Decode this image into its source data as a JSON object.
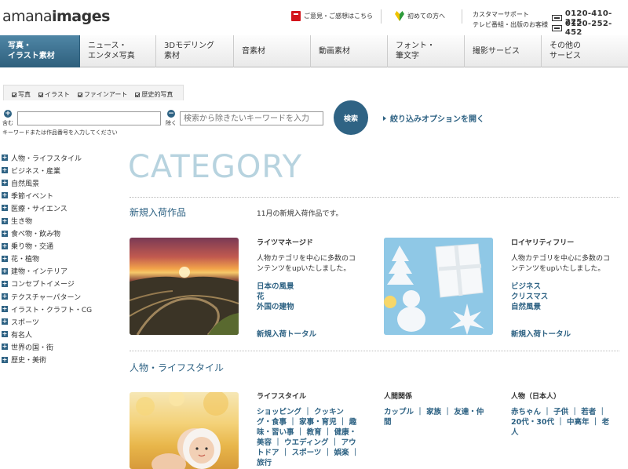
{
  "header": {
    "logo_light": "amana",
    "logo_bold": "images",
    "feedback_link": "ご意見・ご感想はこちら",
    "beginner_link": "初めての方へ",
    "support_title": "カスタマーサポート",
    "support_sub": "テレビ番組・出版のお客様",
    "tel_1": "0120-410-225",
    "tel_2": "0120-252-452"
  },
  "nav": {
    "items": [
      {
        "line1": "写真・",
        "line2": "イラスト素材"
      },
      {
        "line1": "ニュース・",
        "line2": "エンタメ写真"
      },
      {
        "line1": "3Dモデリング",
        "line2": "素材"
      },
      {
        "line1": "音素材",
        "line2": ""
      },
      {
        "line1": "動画素材",
        "line2": ""
      },
      {
        "line1": "フォント・",
        "line2": "筆文字"
      },
      {
        "line1": "撮影サービス",
        "line2": ""
      },
      {
        "line1": "その他の",
        "line2": "サービス"
      }
    ]
  },
  "search": {
    "checks": [
      "写真",
      "イラスト",
      "ファインアート",
      "歴史的写真"
    ],
    "include_label": "含む",
    "exclude_label": "除く",
    "exclude_placeholder": "検索から除きたいキーワードを入力",
    "hint": "キーワードまたは作品番号を入力してください",
    "button": "検索",
    "refine": "絞り込みオプションを開く"
  },
  "sidebar": {
    "items": [
      "人物・ライフスタイル",
      "ビジネス・産業",
      "自然風景",
      "季節イベント",
      "医療・サイエンス",
      "生き物",
      "食べ物・飲み物",
      "乗り物・交通",
      "花・植物",
      "建物・インテリア",
      "コンセプトイメージ",
      "テクスチャーパターン",
      "イラスト・クラフト・CG",
      "スポーツ",
      "有名人",
      "世界の国・街",
      "歴史・美術"
    ]
  },
  "main": {
    "category_title": "CATEGORY",
    "new_section": {
      "title": "新規入荷作品",
      "desc": "11月の新規入荷作品です。",
      "rm": {
        "head": "ライツマネージド",
        "text1": "人物カテゴリを中心に多数のコ",
        "text2": "ンテンツをupいたしました。",
        "links": [
          "日本の風景",
          "花",
          "外国の建物"
        ],
        "total": "新規入荷トータル"
      },
      "rf": {
        "head": "ロイヤリティフリー",
        "text1": "人物カテゴリを中心に多数のコ",
        "text2": "ンテンツをupいたしました。",
        "links": [
          "ビジネス",
          "クリスマス",
          "自然風景"
        ],
        "total": "新規入荷トータル"
      }
    },
    "people_section": {
      "title": "人物・ライフスタイル",
      "lifestyle": {
        "head": "ライフスタイル",
        "lines": [
          "ショッピング ｜ クッキン",
          "グ・食事 ｜ 家事・育児 ｜ 趣",
          "味・習い事 ｜ 教育 ｜ 健康・",
          "美容 ｜ ウエディング ｜ アウ",
          "トドア ｜ スポーツ ｜ 娯楽 ｜",
          "旅行"
        ]
      },
      "relations": {
        "head": "人間関係",
        "lines": [
          "カップル ｜ 家族 ｜ 友達・仲",
          "間"
        ]
      },
      "japanese": {
        "head": "人物（日本人）",
        "lines": [
          "赤ちゃん ｜ 子供 ｜ 若者 ｜",
          "20代・30代 ｜ 中高年 ｜ 老",
          "人"
        ]
      }
    }
  }
}
